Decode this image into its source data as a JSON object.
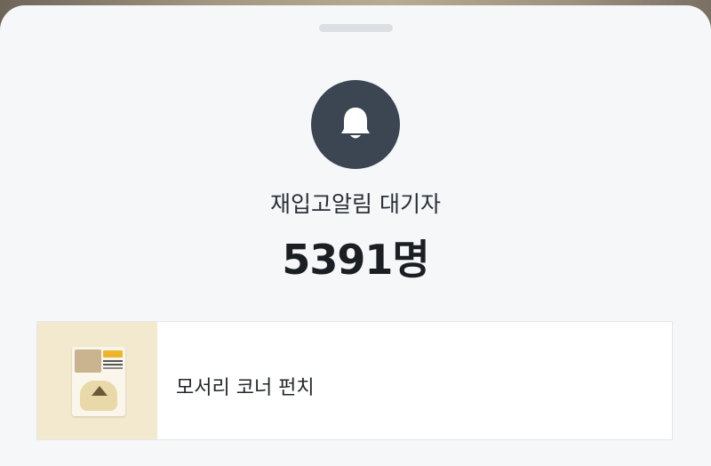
{
  "sheet": {
    "waiting_label": "재입고알림 대기자",
    "waiting_count": "5391명",
    "icon": "bell-icon"
  },
  "product": {
    "name": "모서리 코너 펀치",
    "thumbnail_icon": "product-package-image"
  },
  "colors": {
    "sheet_background": "#f6f7f9",
    "bell_circle": "#3b4652",
    "text_primary": "#1b1f24"
  }
}
